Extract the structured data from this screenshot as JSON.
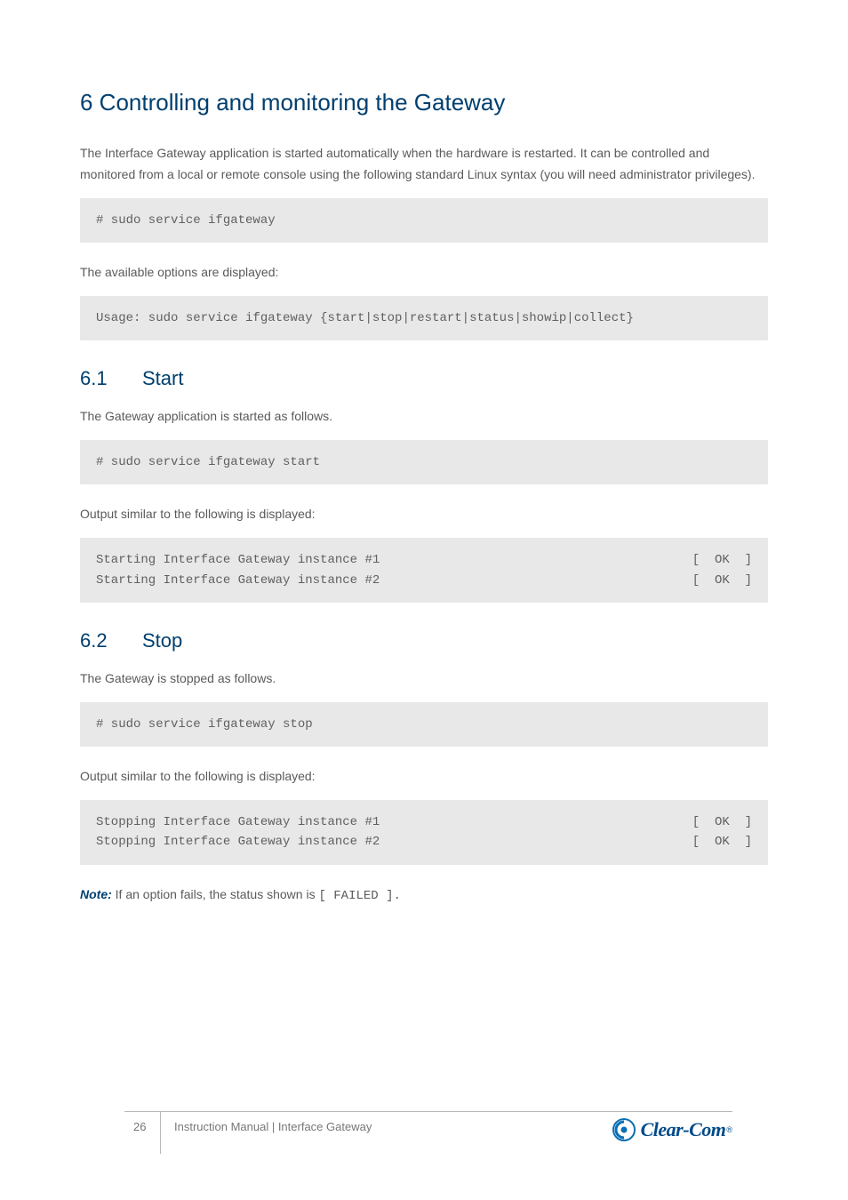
{
  "h1": "6 Controlling and monitoring the Gateway",
  "intro": "The Interface Gateway application is started automatically when the hardware is restarted. It can be controlled and monitored from a local or remote console using the following standard Linux syntax (you will need administrator privileges).",
  "code_usage_cmd": "# sudo service ifgateway",
  "para_available_options": "The available options are displayed:",
  "code_usage_out": "Usage: sudo service ifgateway {start|stop|restart|status|showip|collect}",
  "sections": {
    "start": {
      "num": "6.1",
      "title": "Start",
      "intro": "The Gateway application is started as follows.",
      "code_cmd": "# sudo service ifgateway start",
      "para_out_intro": "Output similar to the following is displayed:",
      "out1_left": "Starting Interface Gateway instance #1",
      "out1_right": "[  OK  ]",
      "out2_left": "Starting Interface Gateway instance #2",
      "out2_right": "[  OK  ]"
    },
    "stop": {
      "num": "6.2",
      "title": "Stop",
      "intro": "The Gateway is stopped as follows.",
      "code_cmd": "# sudo service ifgateway stop",
      "para_out_intro": "Output similar to the following is displayed:",
      "out1_left": "Stopping Interface Gateway instance #1",
      "out1_right": "[  OK  ]",
      "out2_left": "Stopping Interface Gateway instance #2",
      "out2_right": "[  OK  ]"
    }
  },
  "note_label": "Note:",
  "note_text": "If an option fails, the status shown is ",
  "note_failed": "[ FAILED ].",
  "footer": {
    "page": "26",
    "doc": "Instruction Manual | Interface Gateway",
    "logo_text": "Clear-Com",
    "logo_reg": "®"
  }
}
